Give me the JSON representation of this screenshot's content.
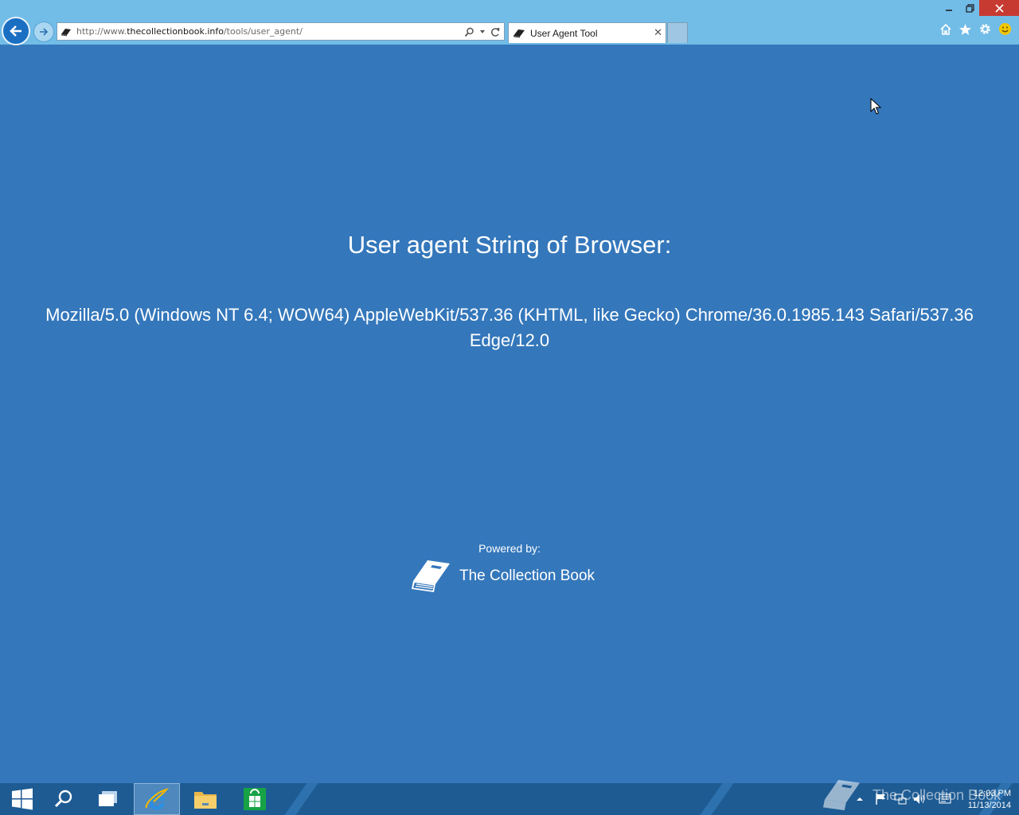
{
  "browser": {
    "url_prefix": "http://www.",
    "url_domain": "thecollectionbook.info",
    "url_path": "/tools/user_agent/",
    "tab_title": "User Agent Tool"
  },
  "page": {
    "heading": "User agent String of Browser:",
    "ua_line1": "Mozilla/5.0 (Windows NT 6.4; WOW64) AppleWebKit/537.36 (KHTML, like Gecko) Chrome/36.0.1985.143 Safari/537.36",
    "ua_line2": "Edge/12.0",
    "powered_label": "Powered by:",
    "brand_name": "The Collection Book"
  },
  "taskbar": {
    "time": "12:03 PM",
    "date": "11/13/2014",
    "watermark": "The Collection Book"
  },
  "icons": [
    "back-arrow-icon",
    "forward-arrow-icon",
    "book-favicon-icon",
    "search-icon",
    "dropdown-icon",
    "refresh-icon",
    "close-icon",
    "home-icon",
    "star-icon",
    "gear-icon",
    "smiley-icon",
    "windows-start-icon",
    "taskbar-search-icon",
    "task-view-icon",
    "ie-icon",
    "file-explorer-icon",
    "store-icon",
    "mouse-cursor-icon"
  ],
  "colors": {
    "page_bg": "#3477bb",
    "chrome_bg": "#72bce8",
    "taskbar_bg": "#1e5b93",
    "close_btn": "#c73a32"
  }
}
